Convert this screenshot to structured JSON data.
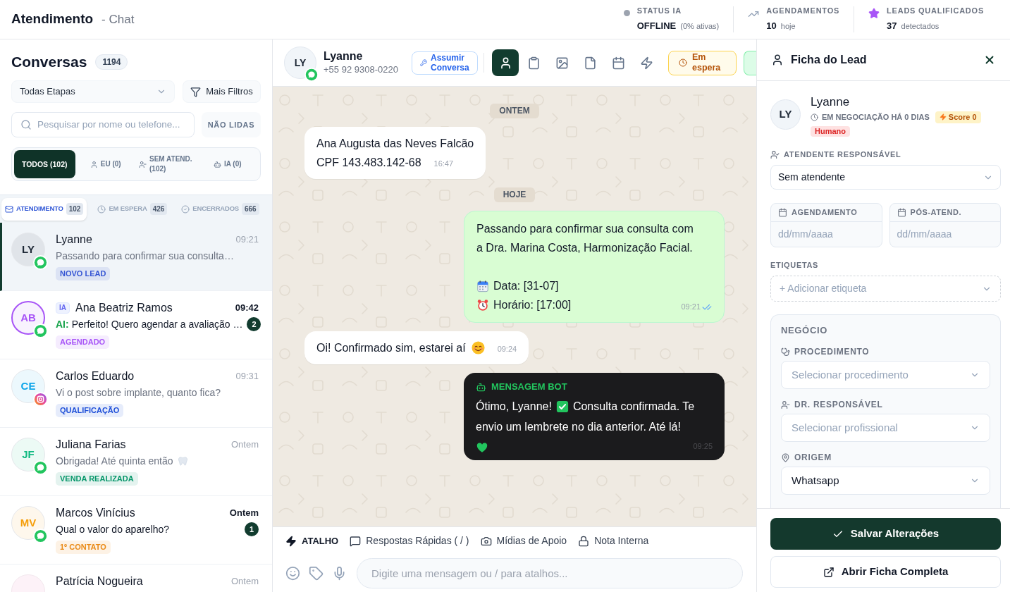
{
  "header": {
    "title": "Atendimento",
    "subtitle": "- Chat",
    "stats": [
      {
        "label": "STATUS IA",
        "value": "OFFLINE",
        "note": "(0% ativas)",
        "color": "#9ca3af"
      },
      {
        "label": "AGENDAMENTOS",
        "value": "10",
        "note": "hoje"
      },
      {
        "label": "LEADS QUALIFICADOS",
        "value": "37",
        "note": "detectados"
      }
    ]
  },
  "conversations": {
    "title": "Conversas",
    "count": "1194",
    "stage_filter": "Todas Etapas",
    "more_filters": "Mais Filtros",
    "search": {
      "placeholder": "Pesquisar por nome ou telefone..."
    },
    "unread_button": "NÃO LIDAS",
    "segments": [
      {
        "label": "TODOS (102)",
        "selected": true
      },
      {
        "label": "EU (0)",
        "selected": false
      },
      {
        "label": "SEM ATEND. (102)",
        "selected": false
      },
      {
        "label": "IA (0)",
        "selected": false
      }
    ],
    "tabs": [
      {
        "label": "ATENDIMENTO",
        "count": "102",
        "selected": true
      },
      {
        "label": "EM ESPERA",
        "count": "426",
        "selected": false
      },
      {
        "label": "ENCERRADOS",
        "count": "666",
        "selected": false
      }
    ],
    "items": [
      {
        "avatar": {
          "initials": "LY",
          "color": "#1f2937"
        },
        "channel": {
          "kind": "whatsapp"
        },
        "name": "Lyanne",
        "time": "09:21",
        "preview": "Passando para confirmar sua consulta…",
        "tag": {
          "text": "NOVO LEAD",
          "color": "#3656d4"
        },
        "selected": true,
        "ai_handled": false
      },
      {
        "avatar": {
          "initials": "AB",
          "color": "#a855f7"
        },
        "channel": {
          "kind": "whatsapp"
        },
        "badge": "IA",
        "name": "Ana Beatriz Ramos",
        "time": "09:42",
        "preview_prefix": "AI:",
        "preview": "Perfeito! Quero agendar a avaliação …",
        "unread": "2",
        "tag": {
          "text": "AGENDADO",
          "color": "#a855f7"
        },
        "selected": false,
        "ai_handled": true
      },
      {
        "avatar": {
          "initials": "CE",
          "color": "#0ea5e9"
        },
        "channel": {
          "kind": "instagram"
        },
        "name": "Carlos Eduardo",
        "time": "09:31",
        "preview": "Vi o post sobre implante, quanto fica?",
        "tag": {
          "text": "QUALIFICAÇÃO",
          "color": "#1d4ed8"
        },
        "selected": false,
        "ai_handled": false
      },
      {
        "avatar": {
          "initials": "JF",
          "color": "#10b981"
        },
        "channel": {
          "kind": "whatsapp"
        },
        "name": "Juliana Farias",
        "time": "Ontem",
        "preview": "Obrigada! Até quinta então",
        "preview_icon": {
          "kind": "tooth"
        },
        "tag": {
          "text": "VENDA REALIZADA",
          "color": "#059669"
        },
        "selected": false,
        "ai_handled": false
      },
      {
        "avatar": {
          "initials": "MV",
          "color": "#f59e0b"
        },
        "channel": {
          "kind": "whatsapp"
        },
        "name": "Marcos Vinícius",
        "time": "Ontem",
        "preview": "Qual o valor do aparelho?",
        "unread": "1",
        "tag": {
          "text": "1º CONTATO",
          "color": "#ea8a16"
        },
        "selected": false,
        "ai_handled": false
      },
      {
        "name": "Patrícia Nogueira",
        "time": "Ontem",
        "selected": false,
        "ai_handled": false
      }
    ]
  },
  "chat": {
    "contact": {
      "initials": "LY",
      "name": "Lyanne",
      "phone": "+55 92 9308-0220",
      "channel": {
        "kind": "whatsapp"
      }
    },
    "assume_button": "Assumir Conversa",
    "tools": [
      {
        "selected": true
      },
      {
        "selected": false
      },
      {
        "selected": false
      },
      {
        "selected": false
      },
      {
        "selected": false
      },
      {
        "selected": false
      }
    ],
    "wait_button": "Em espera",
    "messages": [
      {
        "kind": "date",
        "text": "ONTEM"
      },
      {
        "kind": "incoming",
        "lines": [
          "Ana Augusta das Neves Falcão",
          "CPF 143.483.142-68"
        ],
        "time": "16:47"
      },
      {
        "kind": "date",
        "text": "HOJE"
      },
      {
        "kind": "outgoing",
        "text": "Passando para confirmar sua consulta com a Dra. Marina Costa, Harmonização Facial.",
        "details": [
          {
            "kind": "calendar",
            "text": "Data: [31-07]"
          },
          {
            "kind": "alarm",
            "text": "Horário: [17:00]"
          }
        ],
        "time": "09:21",
        "read": true
      },
      {
        "kind": "incoming",
        "lines": [
          "Oi! Confirmado sim, estarei aí"
        ],
        "emoji": {
          "kind": "smile"
        },
        "time": "09:24"
      },
      {
        "kind": "bot",
        "label": "MENSAGEM BOT",
        "lines": [
          {
            "parts": [
              {
                "kind": "text",
                "text": "Ótimo, Lyanne!"
              },
              {
                "kind": "check"
              },
              {
                "kind": "text",
                "text": "Consulta confirmada. Te"
              }
            ]
          },
          {
            "parts": [
              {
                "kind": "text",
                "text": "envio um lembrete no dia anterior. Até lá!"
              }
            ]
          },
          {
            "parts": [
              {
                "kind": "heart"
              }
            ]
          }
        ],
        "time": "09:25"
      }
    ],
    "shortcuts": [
      {
        "label": "ATALHO",
        "kind": "primary"
      },
      {
        "label": "Respostas Rápidas ( / )",
        "kind": "link"
      },
      {
        "label": "Mídias de Apoio",
        "kind": "link"
      },
      {
        "label": "Nota Interna",
        "kind": "link"
      }
    ],
    "composer": {
      "placeholder": "Digite uma mensagem ou / para atalhos..."
    }
  },
  "lead_panel": {
    "title": "Ficha do Lead",
    "lead": {
      "initials": "LY",
      "name": "Lyanne",
      "stage": "EM NEGOCIAÇÃO HÁ 0 DIAS",
      "score": "Score 0",
      "mode": "Humano"
    },
    "attendant": {
      "label": "ATENDENTE RESPONSÁVEL",
      "value": "Sem atendente"
    },
    "dates": [
      {
        "label": "AGENDAMENTO",
        "placeholder": "dd/mm/aaaa"
      },
      {
        "label": "PÓS-ATEND.",
        "placeholder": "dd/mm/aaaa"
      }
    ],
    "tags": {
      "label": "ETIQUETAS",
      "placeholder": "+ Adicionar etiqueta"
    },
    "business": {
      "title": "NEGÓCIO",
      "fields": [
        {
          "label": "PROCEDIMENTO",
          "placeholder": "Selecionar procedimento"
        },
        {
          "label": "DR. RESPONSÁVEL",
          "placeholder": "Selecionar profissional"
        },
        {
          "label": "ORIGEM",
          "value": "Whatsapp"
        }
      ]
    },
    "save_button": "Salvar Alterações",
    "open_button": "Abrir Ficha Completa"
  }
}
